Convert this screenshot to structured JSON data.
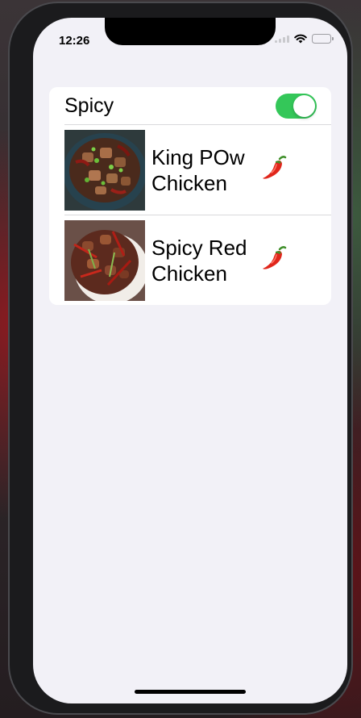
{
  "status_bar": {
    "time": "12:26"
  },
  "spicy_toggle": {
    "label": "Spicy",
    "on": true,
    "on_color": "#34c759"
  },
  "dishes": [
    {
      "name": "King POw Chicken",
      "icon": "chili-pepper-icon",
      "image": "king-pow-chicken-photo"
    },
    {
      "name": "Spicy Red Chicken",
      "icon": "chili-pepper-icon",
      "image": "spicy-red-chicken-photo"
    }
  ]
}
